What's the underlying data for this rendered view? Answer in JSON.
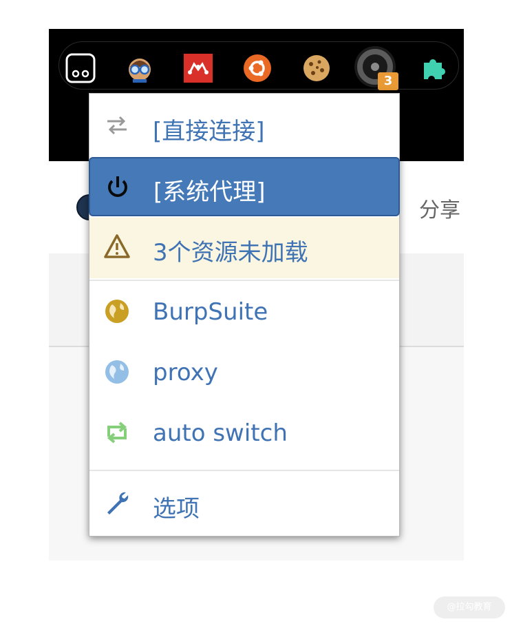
{
  "browser": {
    "share_label": "分享",
    "extension_badge_count": "3",
    "extensions": [
      "ghostery-icon",
      "bespectacled-avatar-icon",
      "mendeley-icon",
      "ubuntu-icon",
      "cookie-icon",
      "switchyomega-icon",
      "puzzle-piece-icon"
    ]
  },
  "menu": {
    "items": [
      {
        "label": "[直接连接]",
        "icon": "direct-connection-arrows-icon",
        "state": "normal"
      },
      {
        "label": "[系统代理]",
        "icon": "power-icon",
        "state": "selected"
      },
      {
        "label": "3个资源未加载",
        "icon": "warning-triangle-icon",
        "state": "warning"
      },
      {
        "label": "BurpSuite",
        "icon": "globe-gold-icon",
        "state": "normal"
      },
      {
        "label": "proxy",
        "icon": "globe-lightblue-icon",
        "state": "normal"
      },
      {
        "label": "auto switch",
        "icon": "auto-switch-icon",
        "state": "normal"
      },
      {
        "label": "选项",
        "icon": "wrench-icon",
        "state": "normal"
      }
    ]
  },
  "colors": {
    "accent": "#4679b8",
    "link": "#3f73b4",
    "warning_bg": "#fbf6e2",
    "badge": "#e99a34"
  },
  "watermark": "@拉勾教育"
}
